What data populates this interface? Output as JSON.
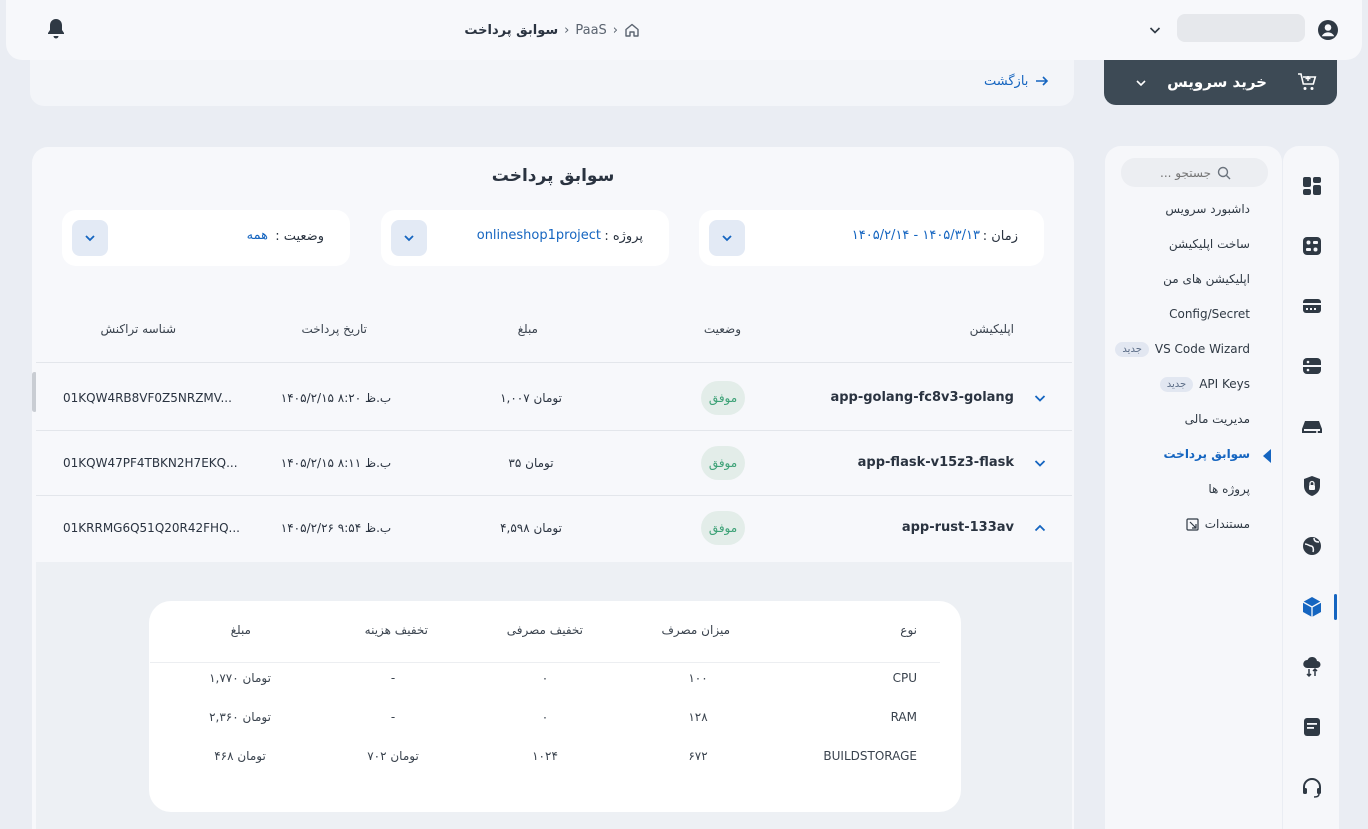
{
  "header": {
    "breadcrumb": [
      "PaaS",
      "سوابق پرداخت"
    ],
    "back_label": "بازگشت",
    "buy_service_label": "خرید سرویس"
  },
  "sidebar": {
    "search_placeholder": "جستجو ...",
    "items": [
      {
        "label": "داشبورد سرویس",
        "new": false
      },
      {
        "label": "ساخت اپلیکیشن",
        "new": false
      },
      {
        "label": "اپلیکیشن های من",
        "new": false
      },
      {
        "label": "Config/Secret",
        "new": false
      },
      {
        "label": "VS Code Wizard",
        "new": true
      },
      {
        "label": "API Keys",
        "new": true
      },
      {
        "label": "مدیریت مالی",
        "new": false
      },
      {
        "label": "سوابق پرداخت",
        "new": false,
        "active": true
      },
      {
        "label": "پروژه ها",
        "new": false
      },
      {
        "label": "مستندات",
        "new": false,
        "external": true
      }
    ],
    "new_badge": "جدید"
  },
  "icon_rail": [
    "dashboard-icon",
    "service-grid-icon",
    "server-icon",
    "database-icon",
    "storage-icon",
    "security-icon",
    "network-icon",
    "paas-cube-icon",
    "cloud-transfer-icon",
    "document-icon",
    "support-headset-icon"
  ],
  "page": {
    "title": "سوابق پرداخت",
    "filters": {
      "time_label": "زمان :",
      "time_value": "۱۴۰۵/۲/۱۴ - ۱۴۰۵/۳/۱۳",
      "project_label": "پروژه :",
      "project_value": "onlineshop1project",
      "status_label": "وضعیت :",
      "status_value": "همه"
    },
    "columns": [
      "اپلیکیشن",
      "وضعیت",
      "مبلغ",
      "تاریخ پرداخت",
      "شناسه تراکنش"
    ],
    "rows": [
      {
        "app": "app-golang-fc8v3-golang",
        "status": "موفق",
        "amount": "۱,۰۰۷ تومان",
        "date": "۱۴۰۵/۲/۱۵  ۸:۲۰ ب.ظ",
        "txid": "01KQW4RB8VF0Z5NRZMV...",
        "expanded": false
      },
      {
        "app": "app-flask-v15z3-flask",
        "status": "موفق",
        "amount": "۳۵ تومان",
        "date": "۱۴۰۵/۲/۱۵  ۸:۱۱ ب.ظ",
        "txid": "01KQW47PF4TBKN2H7EKQ...",
        "expanded": false
      },
      {
        "app": "app-rust-133av",
        "status": "موفق",
        "amount": "۴,۵۹۸ تومان",
        "date": "۱۴۰۵/۲/۲۶  ۹:۵۴ ب.ظ",
        "txid": "01KRRMG6Q51Q20R42FHQ...",
        "expanded": true
      }
    ],
    "detail": {
      "columns": [
        "نوع",
        "میزان مصرف",
        "تخفیف مصرفی",
        "تخفیف هزینه",
        "مبلغ"
      ],
      "rows": [
        {
          "type": "CPU",
          "usage": "۱۰۰",
          "usage_discount": "۰",
          "cost_discount": "-",
          "amount": "۱,۷۷۰ تومان"
        },
        {
          "type": "RAM",
          "usage": "۱۲۸",
          "usage_discount": "۰",
          "cost_discount": "-",
          "amount": "۲,۳۶۰ تومان"
        },
        {
          "type": "BUILDSTORAGE",
          "usage": "۶۷۲",
          "usage_discount": "۱۰۲۴",
          "cost_discount": "۷۰۲ تومان",
          "amount": "۴۶۸ تومان"
        }
      ]
    }
  },
  "colors": {
    "accent": "#1565c0",
    "success": "#3ca176",
    "dark_button": "#3d4a55"
  }
}
